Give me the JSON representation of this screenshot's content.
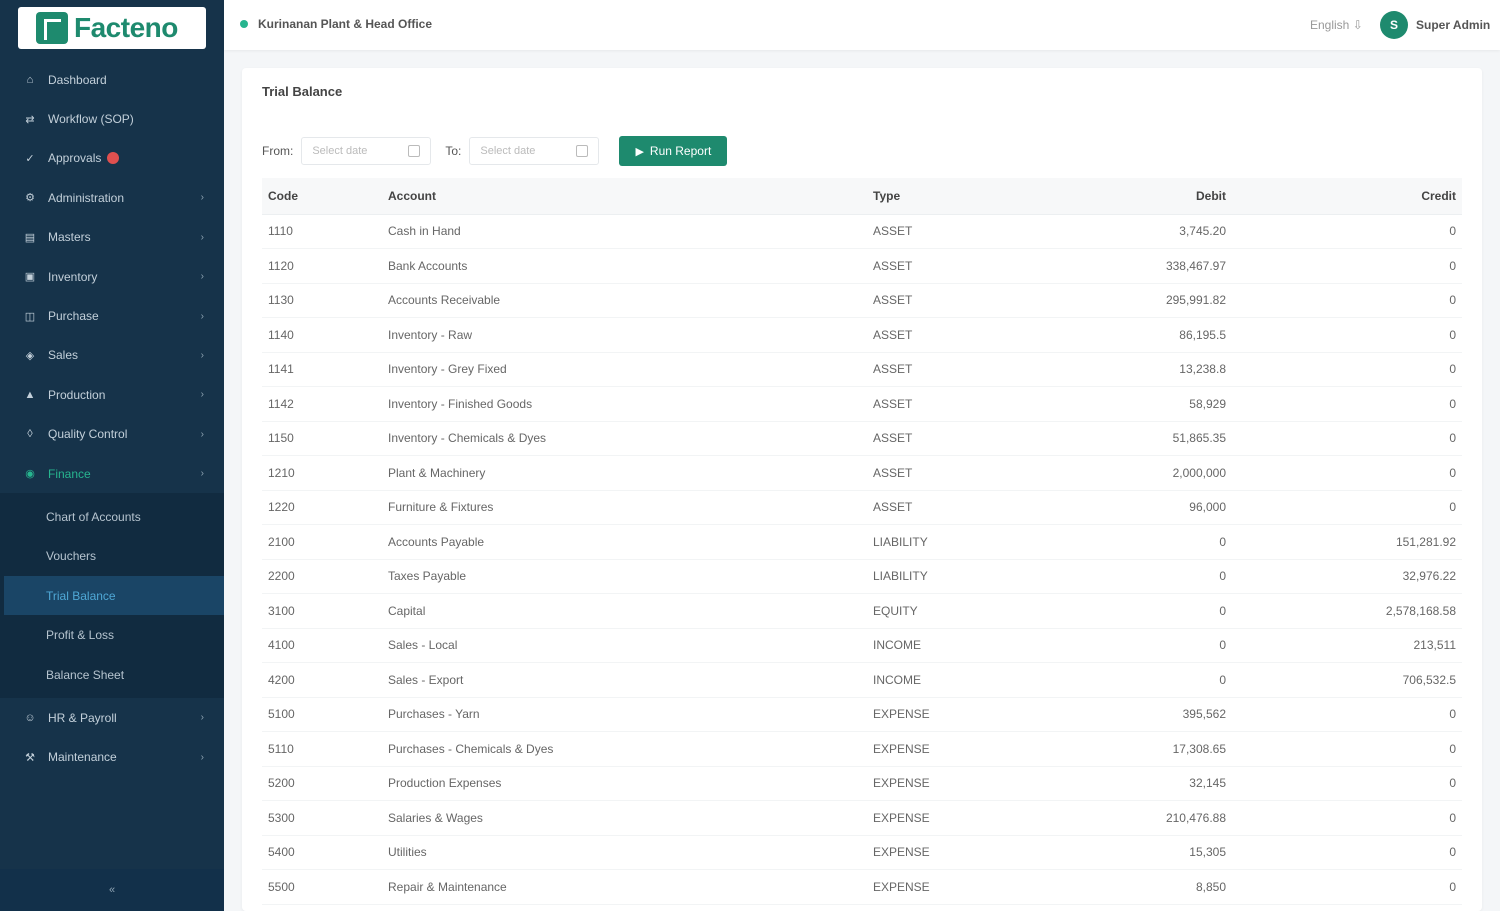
{
  "app": {
    "logo_text": "Facteno"
  },
  "sidebar": {
    "items": [
      {
        "label": "Dashboard",
        "icon": "home-icon"
      },
      {
        "label": "Workflow (SOP)",
        "icon": "workflow-icon"
      },
      {
        "label": "Approvals",
        "icon": "check-icon",
        "badge": true
      },
      {
        "label": "Administration",
        "icon": "settings-icon",
        "chevron": true
      },
      {
        "label": "Masters",
        "icon": "database-icon",
        "chevron": true
      },
      {
        "label": "Inventory",
        "icon": "box-icon",
        "chevron": true
      },
      {
        "label": "Purchase",
        "icon": "cart-icon",
        "chevron": true
      },
      {
        "label": "Sales",
        "icon": "tag-icon",
        "chevron": true
      },
      {
        "label": "Production",
        "icon": "factory-icon",
        "chevron": true
      },
      {
        "label": "Quality Control",
        "icon": "shield-icon",
        "chevron": true
      },
      {
        "label": "Finance",
        "icon": "finance-icon",
        "chevron": true,
        "active": true
      }
    ],
    "finance_sub": [
      {
        "label": "Chart of Accounts"
      },
      {
        "label": "Vouchers"
      },
      {
        "label": "Trial Balance",
        "current": true
      },
      {
        "label": "Profit & Loss"
      },
      {
        "label": "Balance Sheet"
      }
    ],
    "items_after": [
      {
        "label": "HR & Payroll",
        "icon": "users-icon",
        "chevron": true
      },
      {
        "label": "Maintenance",
        "icon": "wrench-icon",
        "chevron": true
      }
    ],
    "collapse_label": "«"
  },
  "topbar": {
    "company": "Kurinanan Plant & Head Office",
    "language": "English ⇩",
    "avatar_initial": "S",
    "user_name": "Super Admin"
  },
  "page": {
    "title": "Trial Balance",
    "from_label": "From:",
    "to_label": "To:",
    "from_placeholder": "Select date",
    "to_placeholder": "Select date",
    "run_button": "Run Report"
  },
  "table": {
    "headers": {
      "code": "Code",
      "account": "Account",
      "type": "Type",
      "debit": "Debit",
      "credit": "Credit"
    },
    "rows": [
      {
        "code": "1110",
        "account": "Cash in Hand",
        "type": "ASSET",
        "debit": "3,745.20",
        "credit": "0"
      },
      {
        "code": "1120",
        "account": "Bank Accounts",
        "type": "ASSET",
        "debit": "338,467.97",
        "credit": "0"
      },
      {
        "code": "1130",
        "account": "Accounts Receivable",
        "type": "ASSET",
        "debit": "295,991.82",
        "credit": "0"
      },
      {
        "code": "1140",
        "account": "Inventory - Raw",
        "type": "ASSET",
        "debit": "86,195.5",
        "credit": "0"
      },
      {
        "code": "1141",
        "account": "Inventory - Grey Fixed",
        "type": "ASSET",
        "debit": "13,238.8",
        "credit": "0"
      },
      {
        "code": "1142",
        "account": "Inventory - Finished Goods",
        "type": "ASSET",
        "debit": "58,929",
        "credit": "0"
      },
      {
        "code": "1150",
        "account": "Inventory - Chemicals & Dyes",
        "type": "ASSET",
        "debit": "51,865.35",
        "credit": "0"
      },
      {
        "code": "1210",
        "account": "Plant & Machinery",
        "type": "ASSET",
        "debit": "2,000,000",
        "credit": "0"
      },
      {
        "code": "1220",
        "account": "Furniture & Fixtures",
        "type": "ASSET",
        "debit": "96,000",
        "credit": "0"
      },
      {
        "code": "2100",
        "account": "Accounts Payable",
        "type": "LIABILITY",
        "debit": "0",
        "credit": "151,281.92"
      },
      {
        "code": "2200",
        "account": "Taxes Payable",
        "type": "LIABILITY",
        "debit": "0",
        "credit": "32,976.22"
      },
      {
        "code": "3100",
        "account": "Capital",
        "type": "EQUITY",
        "debit": "0",
        "credit": "2,578,168.58"
      },
      {
        "code": "4100",
        "account": "Sales - Local",
        "type": "INCOME",
        "debit": "0",
        "credit": "213,511"
      },
      {
        "code": "4200",
        "account": "Sales - Export",
        "type": "INCOME",
        "debit": "0",
        "credit": "706,532.5"
      },
      {
        "code": "5100",
        "account": "Purchases - Yarn",
        "type": "EXPENSE",
        "debit": "395,562",
        "credit": "0"
      },
      {
        "code": "5110",
        "account": "Purchases - Chemicals & Dyes",
        "type": "EXPENSE",
        "debit": "17,308.65",
        "credit": "0"
      },
      {
        "code": "5200",
        "account": "Production Expenses",
        "type": "EXPENSE",
        "debit": "32,145",
        "credit": "0"
      },
      {
        "code": "5300",
        "account": "Salaries & Wages",
        "type": "EXPENSE",
        "debit": "210,476.88",
        "credit": "0"
      },
      {
        "code": "5400",
        "account": "Utilities",
        "type": "EXPENSE",
        "debit": "15,305",
        "credit": "0"
      },
      {
        "code": "5500",
        "account": "Repair & Maintenance",
        "type": "EXPENSE",
        "debit": "8,850",
        "credit": "0"
      }
    ]
  },
  "colors": {
    "sidebar_bg": "#16334a",
    "accent": "#1e8a6e",
    "active_green": "#27b58f",
    "current_link": "#4fa8d6",
    "badge": "#e0504f"
  }
}
